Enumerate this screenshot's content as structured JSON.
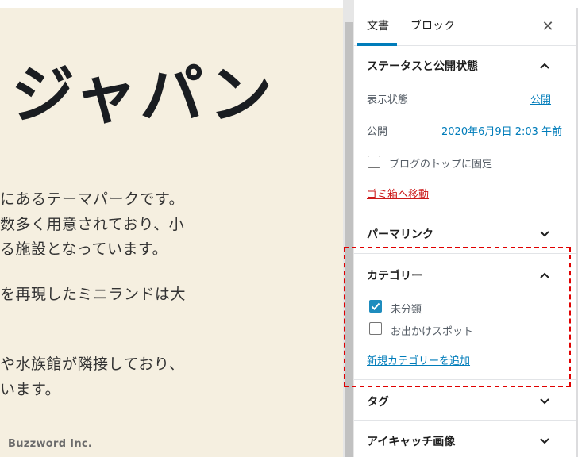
{
  "editor": {
    "title": "ジャパン",
    "body_lines": [
      "にあるテーマパークです。",
      "数多く用意されており、小",
      "る施設となっています。",
      "を再現したミニランドは大",
      "や水族館が隣接しており、",
      "います。"
    ],
    "watermark": "Buzzword Inc."
  },
  "sidebar": {
    "tabs": [
      {
        "label": "文書",
        "active": true
      },
      {
        "label": "ブロック",
        "active": false
      }
    ],
    "close_icon": "close-icon",
    "status_panel": {
      "title": "ステータスと公開状態",
      "visibility_label": "表示状態",
      "visibility_value": "公開",
      "publish_label": "公開",
      "publish_value": "2020年6月9日 2:03 午前",
      "sticky_label": "ブログのトップに固定",
      "sticky_checked": false,
      "trash_label": "ゴミ箱へ移動"
    },
    "permalink_panel": {
      "title": "パーマリンク"
    },
    "category_panel": {
      "title": "カテゴリー",
      "categories": [
        {
          "label": "未分類",
          "checked": true
        },
        {
          "label": "お出かけスポット",
          "checked": false
        }
      ],
      "add_label": "新規カテゴリーを追加"
    },
    "tag_panel": {
      "title": "タグ"
    },
    "featured_image_panel": {
      "title": "アイキャッチ画像"
    }
  },
  "colors": {
    "accent": "#007cba",
    "danger": "#cc1818",
    "canvas": "#f5efe0",
    "highlight": "#e00000"
  }
}
